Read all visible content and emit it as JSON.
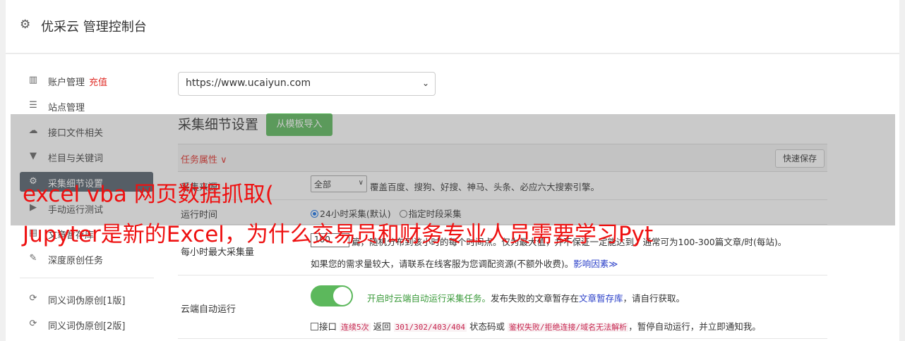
{
  "header": {
    "title": "优采云 管理控制台",
    "icon": "gear-icon"
  },
  "sidebar": {
    "items": [
      {
        "label": "账户管理",
        "extra": "充值",
        "icon": "bar-chart-icon"
      },
      {
        "label": "站点管理",
        "icon": "server-icon"
      },
      {
        "label": "接口文件相关",
        "icon": "cloud-upload-icon"
      },
      {
        "label": "栏目与关键词",
        "icon": "filter-icon"
      },
      {
        "label": "采集细节设置",
        "icon": "cogs-icon",
        "active": true
      },
      {
        "label": "手动运行测试",
        "icon": "play-circle-icon"
      },
      {
        "label": "文章暂存库",
        "icon": "archive-icon"
      },
      {
        "label": "深度原创任务",
        "icon": "edit-icon"
      },
      {
        "label": "同义词伪原创[1版]",
        "icon": "refresh-icon"
      },
      {
        "label": "同义词伪原创[2版]",
        "icon": "refresh-icon"
      }
    ]
  },
  "main": {
    "site_select": "https://www.ucaiyun.com",
    "section_title": "采集细节设置",
    "import_button": "从模板导入",
    "task_attr": "任务属性 ∨",
    "quick_save": "快速保存",
    "engine": {
      "label": "采集来源",
      "select_value": "全部",
      "desc": "覆盖百度、搜狗、好搜、神马、头条、必应六大搜索引擎。"
    },
    "run_time": {
      "label": "运行时间",
      "opt1": "24小时采集(默认)",
      "opt2": "指定时段采集"
    },
    "max_per_hour": {
      "label": "每小时最大采集量",
      "value": "100",
      "desc1": "篇，随机分布到该小时的每个时间点。仅为最大值，并不保证一定能达到，通常可为100-300篇文章/时(每站)。",
      "desc2": "如果您的需求量较大，请联系在线客服为您调配资源(不额外收费)。",
      "link": "影响因素",
      "link_suffix": "≫"
    },
    "cloud_run": {
      "label": "云端自动运行",
      "toggle_on": true,
      "desc_green": "开启时云端自动运行采集任务。",
      "desc": "发布失败的文章暂存在",
      "link": "文章暂存库",
      "desc_tail": "，请自行获取。",
      "check_prefix": "接口",
      "code1": "连续5次",
      "mid1": "返回",
      "code2": "301/302/403/404",
      "mid2": "状态码或",
      "code3": "鉴权失败/拒绝连接/域名无法解析",
      "tail": "，暂停自动运行，并立即通知我。"
    }
  },
  "watermark": {
    "line1": "excel vba 网页数据抓取(",
    "line2": "Jupyter是新的Excel，为什么交易员和财务专业人员需要学习Pyt"
  }
}
